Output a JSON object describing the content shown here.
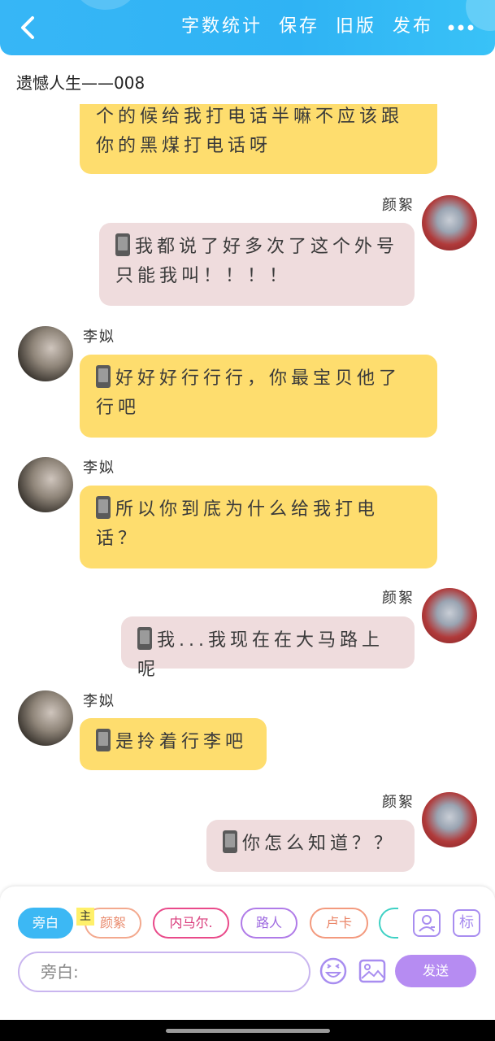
{
  "header": {
    "actions": [
      "字数统计",
      "保存",
      "旧版",
      "发布"
    ],
    "title": "遗憾人生——008"
  },
  "messages": [
    {
      "side": "left",
      "color": "yellow",
      "speaker": "",
      "text": "个的候给我打电话半嘛不应该跟你的黑煤打电话呀",
      "phone_icon": false
    },
    {
      "side": "right",
      "color": "pink",
      "speaker": "颜絮",
      "text": "我都说了好多次了这个外号只能我叫！！！！",
      "phone_icon": true
    },
    {
      "side": "left",
      "color": "yellow",
      "speaker": "李姒",
      "text": "好好好行行行，你最宝贝他了行吧",
      "phone_icon": true
    },
    {
      "side": "left",
      "color": "yellow",
      "speaker": "李姒",
      "text": "所以你到底为什么给我打电话？",
      "phone_icon": true
    },
    {
      "side": "right",
      "color": "pink",
      "speaker": "颜絮",
      "text": "我...我现在在大马路上呢",
      "phone_icon": true
    },
    {
      "side": "left",
      "color": "yellow",
      "speaker": "李姒",
      "text": "是拎着行李吧",
      "phone_icon": true
    },
    {
      "side": "right",
      "color": "pink",
      "speaker": "颜絮",
      "text": "你怎么知道？？",
      "phone_icon": true
    }
  ],
  "roles": [
    {
      "label": "旁白",
      "color": "#3cb8f4",
      "active": true
    },
    {
      "label": "颜絮",
      "color": "#f3a98e",
      "active": false
    },
    {
      "label": "内马尔.",
      "color": "#e94a8a",
      "active": false
    },
    {
      "label": "路人",
      "color": "#b07be8",
      "active": false
    },
    {
      "label": "卢卡",
      "color": "#f39a7e",
      "active": false
    },
    {
      "label": "",
      "color": "#3ed1c4",
      "active": false
    }
  ],
  "host_badge": "主",
  "tag_button": "标",
  "input": {
    "placeholder": "旁白:"
  },
  "send_label": "发送",
  "colors": {
    "topbar": "#37b6f6",
    "yellow_bubble": "#fedd6e",
    "pink_bubble": "#efdcdd",
    "send": "#b68cf2"
  }
}
